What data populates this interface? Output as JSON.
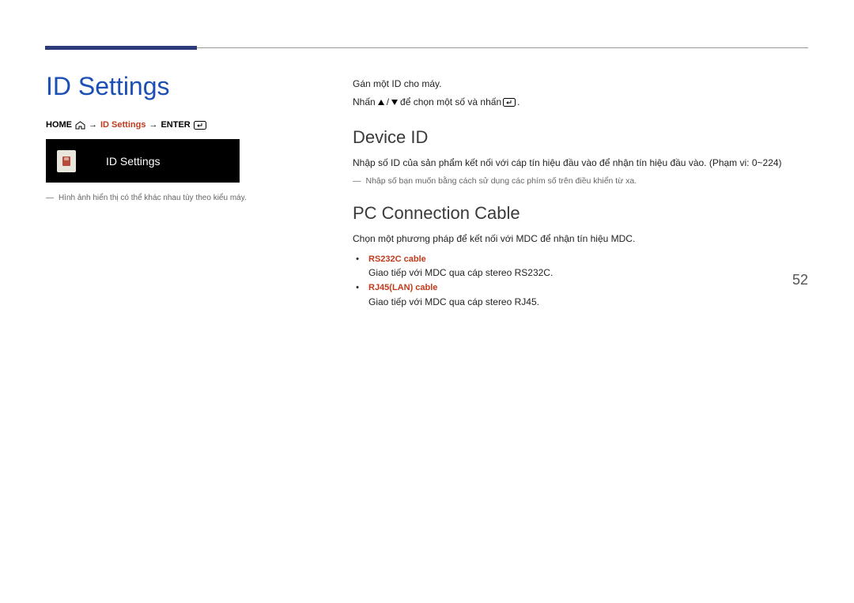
{
  "title": "ID Settings",
  "breadcrumb": {
    "home": "HOME",
    "arrow": "→",
    "idsettings": "ID Settings",
    "enter": "ENTER"
  },
  "panel": {
    "label": "ID Settings"
  },
  "left_note": "Hình ảnh hiển thị có thể khác nhau tùy theo kiểu máy.",
  "intro": {
    "line1": "Gán một ID cho máy.",
    "line2a": "Nhấn ",
    "line2b": " để chọn một số và nhấn ",
    "line2c": "."
  },
  "sections": {
    "device_id": {
      "heading": "Device ID",
      "line": "Nhập số ID của sản phẩm kết nối với cáp tín hiệu đầu vào để nhận tín hiệu đầu vào. (Phạm vi: 0~224)",
      "note": "Nhập số bạn muốn bằng cách sử dụng các phím số trên điều khiển từ xa."
    },
    "pc_conn": {
      "heading": "PC Connection Cable",
      "line": "Chọn một phương pháp để kết nối với MDC để nhận tín hiệu MDC.",
      "items": [
        {
          "title": "RS232C cable",
          "desc": "Giao tiếp với MDC qua cáp stereo RS232C."
        },
        {
          "title": "RJ45(LAN) cable",
          "desc": "Giao tiếp với MDC qua cáp stereo RJ45."
        }
      ]
    }
  },
  "page_number": "52"
}
